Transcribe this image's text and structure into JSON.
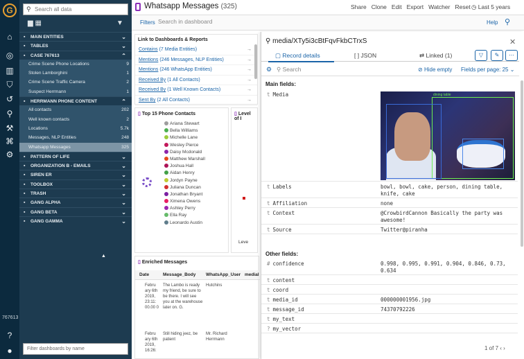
{
  "app": {
    "rail_number": "767613"
  },
  "sidebar": {
    "search_placeholder": "Search all data",
    "footer_placeholder": "Filter dashboards by name",
    "items": [
      {
        "label": "MAIN ENTITIES",
        "type": "hdr",
        "chev": "⌄"
      },
      {
        "label": "TABLES",
        "type": "hdr",
        "chev": "⌄"
      },
      {
        "label": "CASE 767613",
        "type": "hdr",
        "chev": "⌃"
      },
      {
        "label": "Crime Scene Phone Locations",
        "type": "sub",
        "count": "9"
      },
      {
        "label": "Stolen Lamborghini",
        "type": "sub",
        "count": "1"
      },
      {
        "label": "Crime Scene Traffic Camera",
        "type": "sub",
        "count": "2"
      },
      {
        "label": "Suspect Herrmann",
        "type": "sub",
        "count": "1"
      },
      {
        "label": "HERRMANN PHONE CONTENT",
        "type": "hdr",
        "chev": "⌃"
      },
      {
        "label": "All contacts",
        "type": "sub",
        "count": "202"
      },
      {
        "label": "Well known contacts",
        "type": "sub",
        "count": "2"
      },
      {
        "label": "Locations",
        "type": "sub",
        "count": "5.7k"
      },
      {
        "label": "Messages, NLP Entities",
        "type": "sub",
        "count": "248"
      },
      {
        "label": "Whatsapp Messages",
        "type": "sub active",
        "count": "325"
      },
      {
        "label": "PATTERN OF LIFE",
        "type": "hdr",
        "chev": "⌄"
      },
      {
        "label": "ORGANIZATION B - EMAILS",
        "type": "hdr",
        "chev": "⌄"
      },
      {
        "label": "SIREN ER",
        "type": "hdr",
        "chev": "⌄"
      },
      {
        "label": "TOOLBOX",
        "type": "hdr",
        "chev": "⌄"
      },
      {
        "label": "TRASH",
        "type": "hdr",
        "chev": "⌄"
      },
      {
        "label": "GANG ALPHA",
        "type": "hdr",
        "chev": "⌄"
      },
      {
        "label": "GANG BETA",
        "type": "hdr",
        "chev": "⌄"
      },
      {
        "label": "GANG GAMMA",
        "type": "hdr",
        "chev": "⌄"
      }
    ]
  },
  "header": {
    "title": "Whatsapp Messages",
    "count": "(325)",
    "actions": [
      "Share",
      "Clone",
      "Edit",
      "Export",
      "Watcher",
      "Reset"
    ],
    "time": "Last 5 years"
  },
  "filterbar": {
    "filters_label": "Filters",
    "search_placeholder": "Search in dashboard",
    "help_label": "Help"
  },
  "links_panel": {
    "title": "Link to Dashboards & Reports",
    "rows": [
      {
        "link": "Contains",
        "rest": "(7 Media Entities)"
      },
      {
        "link": "Mentions",
        "rest": "(246 Messages, NLP Entities)"
      },
      {
        "link": "Mentions",
        "rest": "(246 WhatsApp Entities)"
      },
      {
        "link": "Received By",
        "rest": "(1 All Contacts)"
      },
      {
        "link": "Received By",
        "rest": "(1 Well Known Contacts)"
      },
      {
        "link": "Sent By",
        "rest": "(2 All Contacts)"
      }
    ]
  },
  "contacts_panel": {
    "title": "Top 15 Phone Contacts",
    "contacts": [
      {
        "name": "Ariana Stewart",
        "color": "#9e9e9e"
      },
      {
        "name": "Bella Williams",
        "color": "#4caf50"
      },
      {
        "name": "Michelle Lane",
        "color": "#9ccc3c"
      },
      {
        "name": "Wesley Pierce",
        "color": "#c2185b"
      },
      {
        "name": "Daisy Mcdonald",
        "color": "#8e24aa"
      },
      {
        "name": "Matthew Marshall",
        "color": "#e64a19"
      },
      {
        "name": "Joshua Hall",
        "color": "#ad1457"
      },
      {
        "name": "Aidan Henry",
        "color": "#43a047"
      },
      {
        "name": "Jordyn Payne",
        "color": "#c0ca33"
      },
      {
        "name": "Juliana Duncan",
        "color": "#d32f2f"
      },
      {
        "name": "Jonathan Bryant",
        "color": "#7b1fa2"
      },
      {
        "name": "Ximena Owens",
        "color": "#e91e63"
      },
      {
        "name": "Ashley Perry",
        "color": "#9c27b0"
      },
      {
        "name": "Ella Ray",
        "color": "#66bb6a"
      },
      {
        "name": "Leonardo Austin",
        "color": "#607d8b"
      }
    ]
  },
  "level_panel": {
    "title": "Level of I",
    "axis": "Leve"
  },
  "enriched_panel": {
    "title": "Enriched Messages",
    "columns": [
      "Date",
      "Message_Body",
      "WhatsApp_User",
      "medial"
    ],
    "rows": [
      {
        "date": "Febru ary 6th 2019, 23:11: 00.00 0",
        "body": "The Lambo is ready my friend, be sure to be there. I will see you at the warehouse later on. G.",
        "user": "Hutchins"
      },
      {
        "date": "Febru ary 6th 2019, 16:26:",
        "body": "Still hiding jeez, be patient",
        "user": "Mr. Richard Herrmann"
      }
    ]
  },
  "record": {
    "title": "media/XTy5i3cBtFqvFkbCTrxS",
    "tabs": {
      "details": "Record details",
      "json": "JSON",
      "linked": "Linked (1)"
    },
    "search_placeholder": "Search",
    "hide_empty": "Hide empty",
    "fields_per_page": "Fields per page: 25",
    "main_fields_label": "Main fields:",
    "other_fields_label": "Other fields:",
    "main_fields": [
      {
        "key": "Media",
        "type": "t",
        "value": ""
      },
      {
        "key": "Labels",
        "type": "t",
        "value": "bowl, bowl, cake, person, dining table, knife, cake"
      },
      {
        "key": "Affiliation",
        "type": "t",
        "value": "none"
      },
      {
        "key": "Context",
        "type": "t",
        "value": "@CrowbirdCannon Basically the party was awesome!"
      },
      {
        "key": "Source",
        "type": "t",
        "value": "Twitter@piranha"
      }
    ],
    "other_fields": [
      {
        "key": "confidence",
        "type": "#",
        "value": "0.998, 0.995, 0.991, 0.904, 0.846, 0.73, 0.634"
      },
      {
        "key": "content",
        "type": "t",
        "value": ""
      },
      {
        "key": "coord",
        "type": "t",
        "value": ""
      },
      {
        "key": "media_id",
        "type": "t",
        "value": "000000001956.jpg"
      },
      {
        "key": "message_id",
        "type": "t",
        "value": "74370792226"
      },
      {
        "key": "my_text",
        "type": "t",
        "value": ""
      },
      {
        "key": "my_vector",
        "type": "?",
        "value": ""
      }
    ],
    "pager": "1 of 7",
    "photo_labels": [
      "dining table"
    ]
  }
}
